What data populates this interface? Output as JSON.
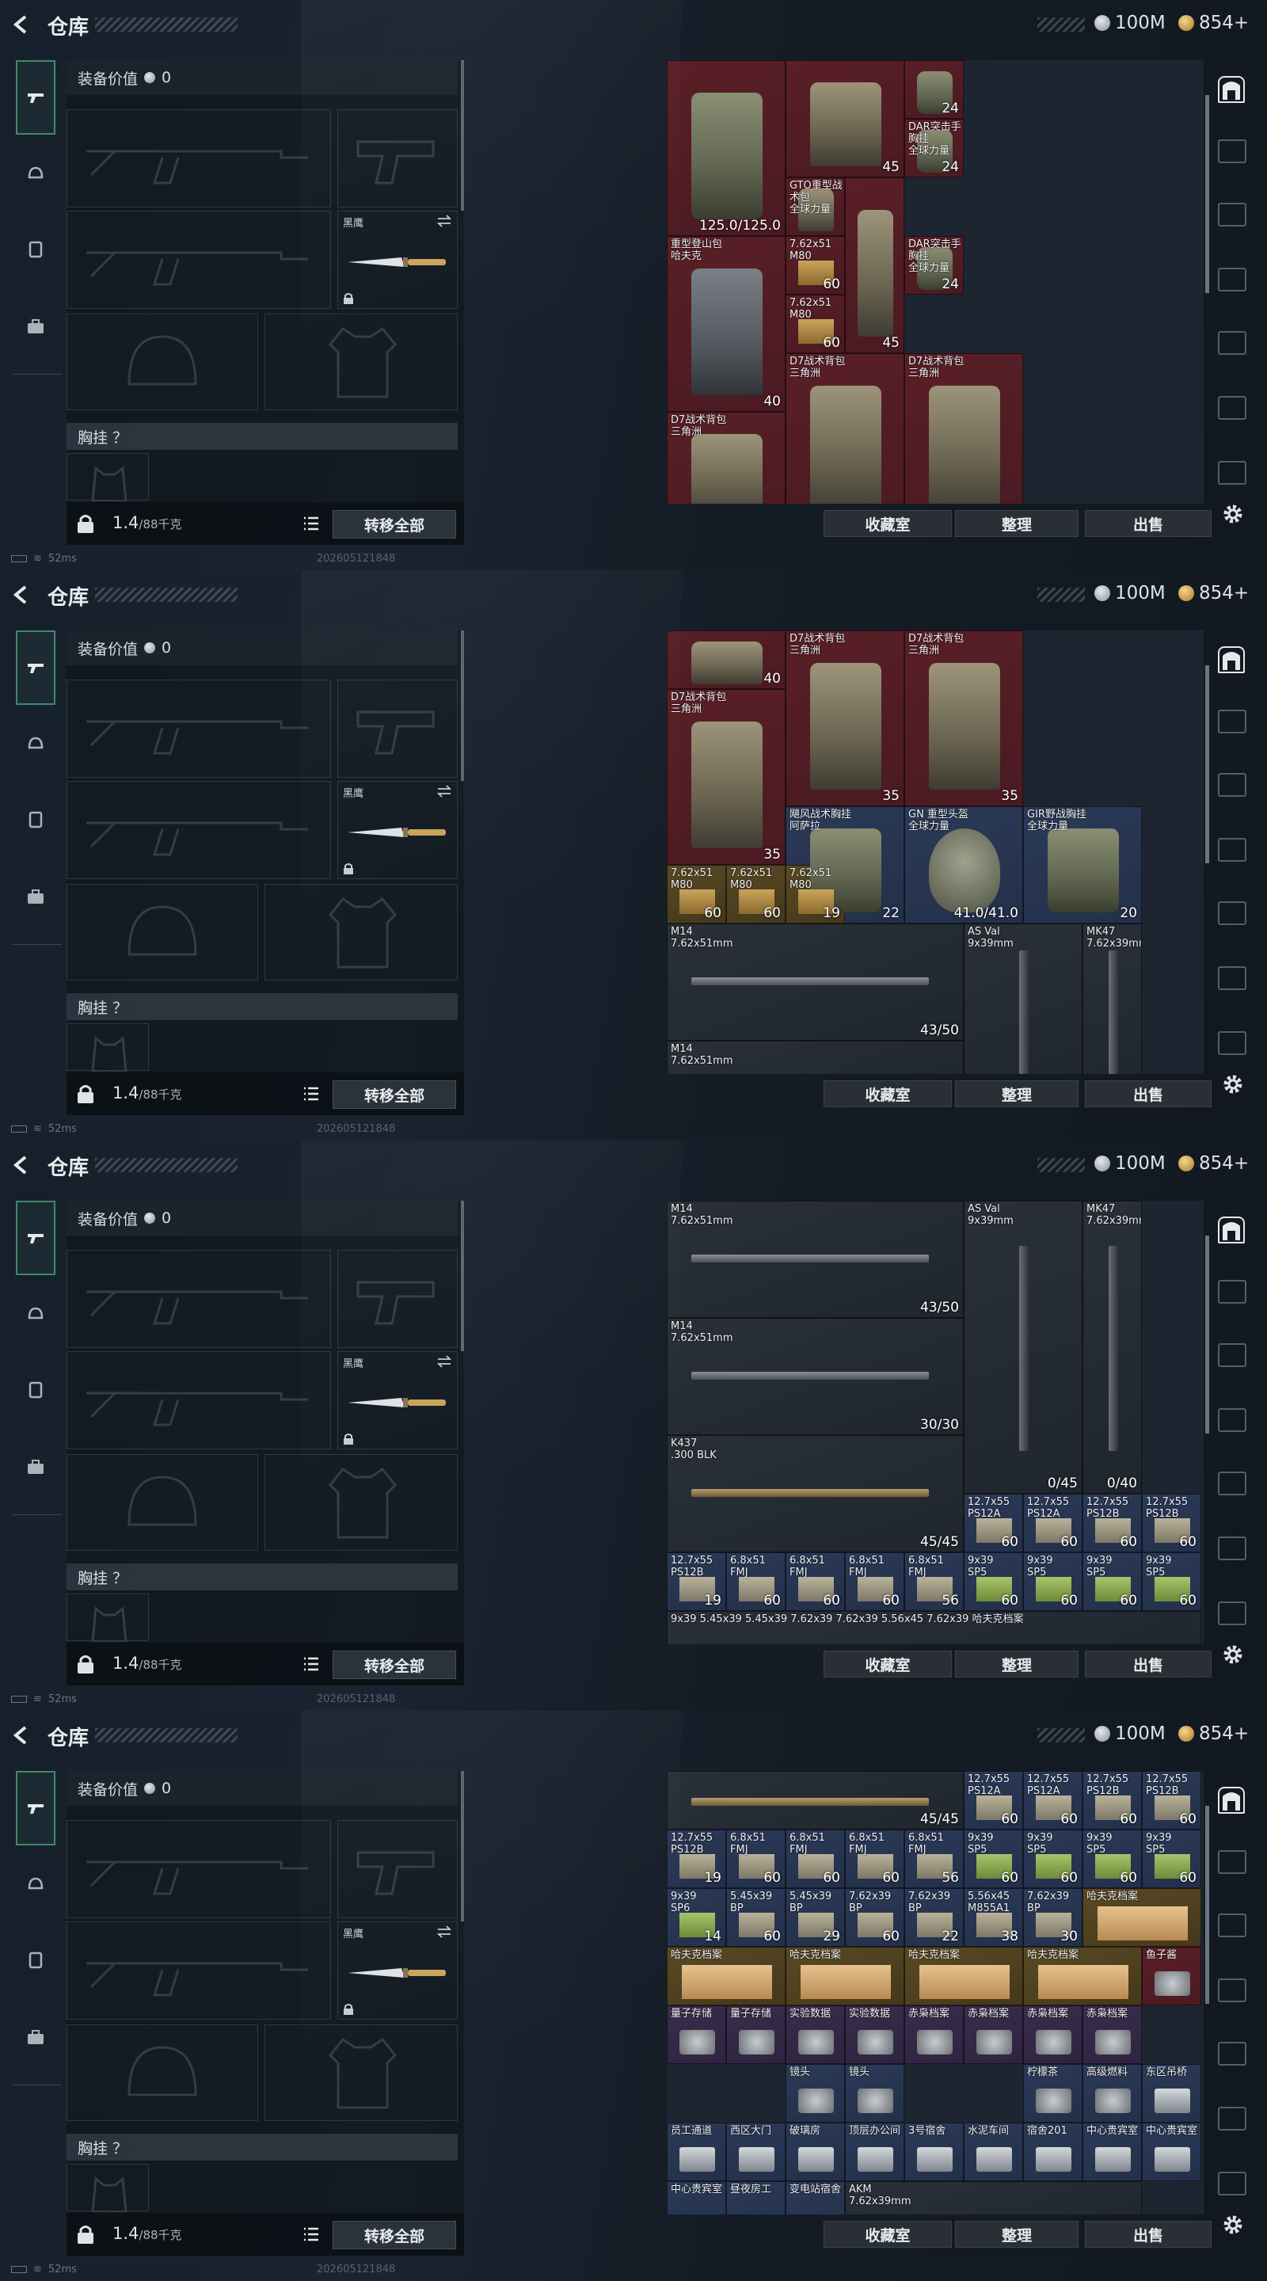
{
  "header": {
    "title": "仓库",
    "silver": "100M",
    "gold": "854+"
  },
  "equip": {
    "value_label": "装备价值",
    "value": "0",
    "knife_name": "黑鹰",
    "section_chest": "胸挂 ？",
    "weight": "1.4",
    "weight_max": "/88千克",
    "transfer": "转移全部"
  },
  "actions": {
    "collection": "收藏室",
    "organize": "整理",
    "sell": "出售"
  },
  "status": {
    "ping": "52ms",
    "build": "202605121848"
  },
  "frames": [
    {
      "items": [
        {
          "x": 0,
          "y": 0,
          "w": 2,
          "h": 3,
          "c": "red",
          "n": "",
          "q": "125.0/125.0",
          "art": "vest"
        },
        {
          "x": 2,
          "y": 0,
          "w": 2,
          "h": 2,
          "c": "red",
          "n": "",
          "q": "45",
          "art": "bag"
        },
        {
          "x": 4,
          "y": 0,
          "w": 1,
          "h": 1,
          "c": "red",
          "n": "",
          "q": "24",
          "art": "vest"
        },
        {
          "x": 4,
          "y": 1,
          "w": 1,
          "h": 1,
          "c": "red",
          "n": "DAR突击手胸挂\n全球力量",
          "q": "24",
          "art": "vest"
        },
        {
          "x": 2,
          "y": 2,
          "w": 1,
          "h": 1,
          "c": "red",
          "n": "GTO重型战术包\n全球力量",
          "q": "",
          "art": "bag"
        },
        {
          "x": 0,
          "y": 3,
          "w": 2,
          "h": 3,
          "c": "red",
          "n": "重型登山包\n哈夫克",
          "q": "40",
          "art": "bag grey"
        },
        {
          "x": 2,
          "y": 3,
          "w": 1,
          "h": 1,
          "c": "red",
          "n": "7.62x51\nM80",
          "q": "60",
          "art": "box"
        },
        {
          "x": 3,
          "y": 2,
          "w": 1,
          "h": 3,
          "c": "red",
          "n": "",
          "q": "45",
          "art": "bag"
        },
        {
          "x": 4,
          "y": 3,
          "w": 1,
          "h": 1,
          "c": "red",
          "n": "DAR突击手胸挂\n全球力量",
          "q": "24",
          "art": "vest"
        },
        {
          "x": 2,
          "y": 4,
          "w": 1,
          "h": 1,
          "c": "red",
          "n": "7.62x51\nM80",
          "q": "60",
          "art": "box"
        },
        {
          "x": 0,
          "y": 6,
          "w": 2,
          "h": 2,
          "c": "red",
          "n": "D7战术背包\n三角洲",
          "q": "",
          "art": "bag"
        },
        {
          "x": 2,
          "y": 5,
          "w": 2,
          "h": 3,
          "c": "red",
          "n": "D7战术背包\n三角洲",
          "q": "",
          "art": "bag"
        },
        {
          "x": 4,
          "y": 5,
          "w": 2,
          "h": 3,
          "c": "red",
          "n": "D7战术背包\n三角洲",
          "q": "",
          "art": "bag"
        }
      ]
    },
    {
      "items": [
        {
          "x": 0,
          "y": 0,
          "w": 2,
          "h": 1,
          "c": "red",
          "n": "",
          "q": "40",
          "art": "bag"
        },
        {
          "x": 2,
          "y": 0,
          "w": 2,
          "h": 3,
          "c": "red",
          "n": "D7战术背包\n三角洲",
          "q": "35",
          "art": "bag"
        },
        {
          "x": 4,
          "y": 0,
          "w": 2,
          "h": 3,
          "c": "red",
          "n": "D7战术背包\n三角洲",
          "q": "35",
          "art": "bag"
        },
        {
          "x": 0,
          "y": 1,
          "w": 2,
          "h": 3,
          "c": "red",
          "n": "D7战术背包\n三角洲",
          "q": "35",
          "art": "bag"
        },
        {
          "x": 2,
          "y": 3,
          "w": 2,
          "h": 2,
          "c": "blue",
          "n": "飓风战术胸挂\n阿萨拉",
          "q": "22",
          "art": "vest"
        },
        {
          "x": 4,
          "y": 3,
          "w": 2,
          "h": 2,
          "c": "blue",
          "n": "GN 重型头盔\n全球力量",
          "q": "41.0/41.0",
          "art": "helmet"
        },
        {
          "x": 6,
          "y": 3,
          "w": 2,
          "h": 2,
          "c": "blue",
          "n": "GIR野战胸挂\n全球力量",
          "q": "20",
          "art": "vest"
        },
        {
          "x": 0,
          "y": 4,
          "w": 1,
          "h": 1,
          "c": "gold",
          "n": "7.62x51\nM80",
          "q": "60",
          "art": "box"
        },
        {
          "x": 1,
          "y": 4,
          "w": 1,
          "h": 1,
          "c": "gold",
          "n": "7.62x51\nM80",
          "q": "60",
          "art": "box"
        },
        {
          "x": 2,
          "y": 4,
          "w": 1,
          "h": 1,
          "c": "gold",
          "n": "7.62x51\nM80",
          "q": "19",
          "art": "box"
        },
        {
          "x": 0,
          "y": 5,
          "w": 5,
          "h": 2,
          "c": "dark",
          "n": "M14\n7.62x51mm",
          "q": "43/50",
          "art": "rifle"
        },
        {
          "x": 5,
          "y": 5,
          "w": 2,
          "h": 3,
          "c": "dark",
          "n": "AS Val\n9x39mm",
          "q": "",
          "art": "rifle v"
        },
        {
          "x": 7,
          "y": 5,
          "w": 1,
          "h": 3,
          "c": "dark",
          "n": "MK47\n7.62x39mm",
          "q": "",
          "art": "rifle v"
        },
        {
          "x": 0,
          "y": 7,
          "w": 5,
          "h": 1,
          "c": "dark",
          "n": "M14\n7.62x51mm",
          "q": "",
          "art": ""
        }
      ]
    },
    {
      "items": [
        {
          "x": 0,
          "y": 0,
          "w": 5,
          "h": 2,
          "c": "dark",
          "n": "M14\n7.62x51mm",
          "q": "43/50",
          "art": "rifle"
        },
        {
          "x": 5,
          "y": 0,
          "w": 2,
          "h": 5,
          "c": "dark",
          "n": "AS Val\n9x39mm",
          "q": "0/45",
          "art": "rifle v"
        },
        {
          "x": 7,
          "y": 0,
          "w": 1,
          "h": 5,
          "c": "dark",
          "n": "MK47\n7.62x39mm",
          "q": "0/40",
          "art": "rifle v"
        },
        {
          "x": 0,
          "y": 2,
          "w": 5,
          "h": 2,
          "c": "dark",
          "n": "M14\n7.62x51mm",
          "q": "30/30",
          "art": "rifle"
        },
        {
          "x": 0,
          "y": 4,
          "w": 5,
          "h": 2,
          "c": "dark",
          "n": "K437\n.300 BLK",
          "q": "45/45",
          "art": "rifle tan"
        },
        {
          "x": 5,
          "y": 5,
          "w": 1,
          "h": 1,
          "c": "blue",
          "n": "12.7x55\nPS12A",
          "q": "60",
          "art": "ammo"
        },
        {
          "x": 6,
          "y": 5,
          "w": 1,
          "h": 1,
          "c": "blue",
          "n": "12.7x55\nPS12A",
          "q": "60",
          "art": "ammo"
        },
        {
          "x": 7,
          "y": 5,
          "w": 1,
          "h": 1,
          "c": "blue",
          "n": "12.7x55\nPS12B",
          "q": "60",
          "art": "ammo"
        },
        {
          "x": 8,
          "y": 5,
          "w": 1,
          "h": 1,
          "c": "blue",
          "n": "12.7x55\nPS12B",
          "q": "60",
          "art": "ammo"
        },
        {
          "x": 0,
          "y": 6,
          "w": 1,
          "h": 1,
          "c": "blue",
          "n": "12.7x55\nPS12B",
          "q": "19",
          "art": "ammo"
        },
        {
          "x": 1,
          "y": 6,
          "w": 1,
          "h": 1,
          "c": "blue",
          "n": "6.8x51\nFMJ",
          "q": "60",
          "art": "ammo"
        },
        {
          "x": 2,
          "y": 6,
          "w": 1,
          "h": 1,
          "c": "blue",
          "n": "6.8x51\nFMJ",
          "q": "60",
          "art": "ammo"
        },
        {
          "x": 3,
          "y": 6,
          "w": 1,
          "h": 1,
          "c": "blue",
          "n": "6.8x51\nFMJ",
          "q": "60",
          "art": "ammo"
        },
        {
          "x": 4,
          "y": 6,
          "w": 1,
          "h": 1,
          "c": "blue",
          "n": "6.8x51\nFMJ",
          "q": "56",
          "art": "ammo"
        },
        {
          "x": 5,
          "y": 6,
          "w": 1,
          "h": 1,
          "c": "blue",
          "n": "9x39\nSP5",
          "q": "60",
          "art": "ammo green"
        },
        {
          "x": 6,
          "y": 6,
          "w": 1,
          "h": 1,
          "c": "blue",
          "n": "9x39\nSP5",
          "q": "60",
          "art": "ammo green"
        },
        {
          "x": 7,
          "y": 6,
          "w": 1,
          "h": 1,
          "c": "blue",
          "n": "9x39\nSP5",
          "q": "60",
          "art": "ammo green"
        },
        {
          "x": 8,
          "y": 6,
          "w": 1,
          "h": 1,
          "c": "blue",
          "n": "9x39\nSP5",
          "q": "60",
          "art": "ammo green"
        },
        {
          "x": 0,
          "y": 7,
          "w": 9,
          "h": 1,
          "c": "dark",
          "n": "9x39        5.45x39     5.45x39     7.62x39     7.62x39     5.56x45     7.62x39     哈夫克档案",
          "q": "",
          "art": ""
        }
      ]
    },
    {
      "items": [
        {
          "x": 0,
          "y": 0,
          "w": 5,
          "h": 1,
          "c": "dark",
          "n": "",
          "q": "45/45",
          "art": "rifle tan"
        },
        {
          "x": 5,
          "y": 0,
          "w": 1,
          "h": 1,
          "c": "blue",
          "n": "12.7x55\nPS12A",
          "q": "60",
          "art": "ammo"
        },
        {
          "x": 6,
          "y": 0,
          "w": 1,
          "h": 1,
          "c": "blue",
          "n": "12.7x55\nPS12A",
          "q": "60",
          "art": "ammo"
        },
        {
          "x": 7,
          "y": 0,
          "w": 1,
          "h": 1,
          "c": "blue",
          "n": "12.7x55\nPS12B",
          "q": "60",
          "art": "ammo"
        },
        {
          "x": 8,
          "y": 0,
          "w": 1,
          "h": 1,
          "c": "blue",
          "n": "12.7x55\nPS12B",
          "q": "60",
          "art": "ammo"
        },
        {
          "x": 0,
          "y": 1,
          "w": 1,
          "h": 1,
          "c": "blue",
          "n": "12.7x55\nPS12B",
          "q": "19",
          "art": "ammo"
        },
        {
          "x": 1,
          "y": 1,
          "w": 1,
          "h": 1,
          "c": "blue",
          "n": "6.8x51\nFMJ",
          "q": "60",
          "art": "ammo"
        },
        {
          "x": 2,
          "y": 1,
          "w": 1,
          "h": 1,
          "c": "blue",
          "n": "6.8x51\nFMJ",
          "q": "60",
          "art": "ammo"
        },
        {
          "x": 3,
          "y": 1,
          "w": 1,
          "h": 1,
          "c": "blue",
          "n": "6.8x51\nFMJ",
          "q": "60",
          "art": "ammo"
        },
        {
          "x": 4,
          "y": 1,
          "w": 1,
          "h": 1,
          "c": "blue",
          "n": "6.8x51\nFMJ",
          "q": "56",
          "art": "ammo"
        },
        {
          "x": 5,
          "y": 1,
          "w": 1,
          "h": 1,
          "c": "blue",
          "n": "9x39\nSP5",
          "q": "60",
          "art": "ammo green"
        },
        {
          "x": 6,
          "y": 1,
          "w": 1,
          "h": 1,
          "c": "blue",
          "n": "9x39\nSP5",
          "q": "60",
          "art": "ammo green"
        },
        {
          "x": 7,
          "y": 1,
          "w": 1,
          "h": 1,
          "c": "blue",
          "n": "9x39\nSP5",
          "q": "60",
          "art": "ammo green"
        },
        {
          "x": 8,
          "y": 1,
          "w": 1,
          "h": 1,
          "c": "blue",
          "n": "9x39\nSP5",
          "q": "60",
          "art": "ammo green"
        },
        {
          "x": 0,
          "y": 2,
          "w": 1,
          "h": 1,
          "c": "blue",
          "n": "9x39\nSP6",
          "q": "14",
          "art": "ammo green"
        },
        {
          "x": 1,
          "y": 2,
          "w": 1,
          "h": 1,
          "c": "blue",
          "n": "5.45x39\nBP",
          "q": "60",
          "art": "ammo"
        },
        {
          "x": 2,
          "y": 2,
          "w": 1,
          "h": 1,
          "c": "blue",
          "n": "5.45x39\nBP",
          "q": "29",
          "art": "ammo"
        },
        {
          "x": 3,
          "y": 2,
          "w": 1,
          "h": 1,
          "c": "blue",
          "n": "7.62x39\nBP",
          "q": "60",
          "art": "ammo"
        },
        {
          "x": 4,
          "y": 2,
          "w": 1,
          "h": 1,
          "c": "blue",
          "n": "7.62x39\nBP",
          "q": "22",
          "art": "ammo"
        },
        {
          "x": 5,
          "y": 2,
          "w": 1,
          "h": 1,
          "c": "blue",
          "n": "5.56x45\nM855A1",
          "q": "38",
          "art": "ammo"
        },
        {
          "x": 6,
          "y": 2,
          "w": 1,
          "h": 1,
          "c": "blue",
          "n": "7.62x39\nBP",
          "q": "30",
          "art": "ammo"
        },
        {
          "x": 7,
          "y": 2,
          "w": 2,
          "h": 1,
          "c": "gold",
          "n": "哈夫克档案",
          "q": "",
          "art": "folder"
        },
        {
          "x": 0,
          "y": 3,
          "w": 2,
          "h": 1,
          "c": "gold",
          "n": "哈夫克档案",
          "q": "",
          "art": "folder"
        },
        {
          "x": 2,
          "y": 3,
          "w": 2,
          "h": 1,
          "c": "gold",
          "n": "哈夫克档案",
          "q": "",
          "art": "folder"
        },
        {
          "x": 4,
          "y": 3,
          "w": 2,
          "h": 1,
          "c": "gold",
          "n": "哈夫克档案",
          "q": "",
          "art": "folder"
        },
        {
          "x": 6,
          "y": 3,
          "w": 2,
          "h": 1,
          "c": "gold",
          "n": "哈夫克档案",
          "q": "",
          "art": "folder"
        },
        {
          "x": 8,
          "y": 3,
          "w": 1,
          "h": 1,
          "c": "red",
          "n": "鱼子酱",
          "q": "",
          "art": "small"
        },
        {
          "x": 0,
          "y": 4,
          "w": 1,
          "h": 1,
          "c": "purple",
          "n": "量子存储",
          "q": "",
          "art": "small"
        },
        {
          "x": 1,
          "y": 4,
          "w": 1,
          "h": 1,
          "c": "purple",
          "n": "量子存储",
          "q": "",
          "art": "small"
        },
        {
          "x": 2,
          "y": 4,
          "w": 1,
          "h": 1,
          "c": "purple",
          "n": "实验数据",
          "q": "",
          "art": "small"
        },
        {
          "x": 3,
          "y": 4,
          "w": 1,
          "h": 1,
          "c": "purple",
          "n": "实验数据",
          "q": "",
          "art": "small"
        },
        {
          "x": 4,
          "y": 4,
          "w": 1,
          "h": 1,
          "c": "purple",
          "n": "赤枭档案",
          "q": "",
          "art": "small"
        },
        {
          "x": 5,
          "y": 4,
          "w": 1,
          "h": 1,
          "c": "purple",
          "n": "赤枭档案",
          "q": "",
          "art": "small"
        },
        {
          "x": 6,
          "y": 4,
          "w": 1,
          "h": 1,
          "c": "purple",
          "n": "赤枭档案",
          "q": "",
          "art": "small"
        },
        {
          "x": 7,
          "y": 4,
          "w": 1,
          "h": 1,
          "c": "purple",
          "n": "赤枭档案",
          "q": "",
          "art": "small"
        },
        {
          "x": 2,
          "y": 5,
          "w": 1,
          "h": 1,
          "c": "blue",
          "n": "镜头",
          "q": "",
          "art": "small"
        },
        {
          "x": 3,
          "y": 5,
          "w": 1,
          "h": 1,
          "c": "blue",
          "n": "镜头",
          "q": "",
          "art": "small"
        },
        {
          "x": 6,
          "y": 5,
          "w": 1,
          "h": 1,
          "c": "blue",
          "n": "柠檬茶",
          "q": "",
          "art": "small"
        },
        {
          "x": 7,
          "y": 5,
          "w": 1,
          "h": 1,
          "c": "blue",
          "n": "高级燃料",
          "q": "",
          "art": "small"
        },
        {
          "x": 8,
          "y": 5,
          "w": 1,
          "h": 1,
          "c": "blue",
          "n": "东区吊桥",
          "q": "",
          "art": "keycard"
        },
        {
          "x": 0,
          "y": 6,
          "w": 1,
          "h": 1,
          "c": "blue",
          "n": "员工通道",
          "q": "",
          "art": "keycard"
        },
        {
          "x": 1,
          "y": 6,
          "w": 1,
          "h": 1,
          "c": "blue",
          "n": "西区大门",
          "q": "",
          "art": "keycard"
        },
        {
          "x": 2,
          "y": 6,
          "w": 1,
          "h": 1,
          "c": "blue",
          "n": "破璃房",
          "q": "",
          "art": "keycard"
        },
        {
          "x": 3,
          "y": 6,
          "w": 1,
          "h": 1,
          "c": "blue",
          "n": "顶层办公间",
          "q": "",
          "art": "keycard"
        },
        {
          "x": 4,
          "y": 6,
          "w": 1,
          "h": 1,
          "c": "blue",
          "n": "3号宿舍",
          "q": "",
          "art": "keycard"
        },
        {
          "x": 5,
          "y": 6,
          "w": 1,
          "h": 1,
          "c": "blue",
          "n": "水泥车间",
          "q": "",
          "art": "keycard"
        },
        {
          "x": 6,
          "y": 6,
          "w": 1,
          "h": 1,
          "c": "blue",
          "n": "宿舍201",
          "q": "",
          "art": "keycard"
        },
        {
          "x": 7,
          "y": 6,
          "w": 1,
          "h": 1,
          "c": "blue",
          "n": "中心贵宾室",
          "q": "",
          "art": "keycard"
        },
        {
          "x": 8,
          "y": 6,
          "w": 1,
          "h": 1,
          "c": "blue",
          "n": "中心贵宾室",
          "q": "",
          "art": "keycard"
        },
        {
          "x": 0,
          "y": 7,
          "w": 1,
          "h": 1,
          "c": "blue",
          "n": "中心贵宾室",
          "q": "",
          "art": ""
        },
        {
          "x": 1,
          "y": 7,
          "w": 1,
          "h": 1,
          "c": "blue",
          "n": "昼夜房工",
          "q": "",
          "art": ""
        },
        {
          "x": 2,
          "y": 7,
          "w": 1,
          "h": 1,
          "c": "blue",
          "n": "变电站宿舍",
          "q": "",
          "art": ""
        },
        {
          "x": 3,
          "y": 7,
          "w": 5,
          "h": 1,
          "c": "dark",
          "n": "AKM\n7.62x39mm",
          "q": "",
          "art": ""
        }
      ]
    }
  ]
}
